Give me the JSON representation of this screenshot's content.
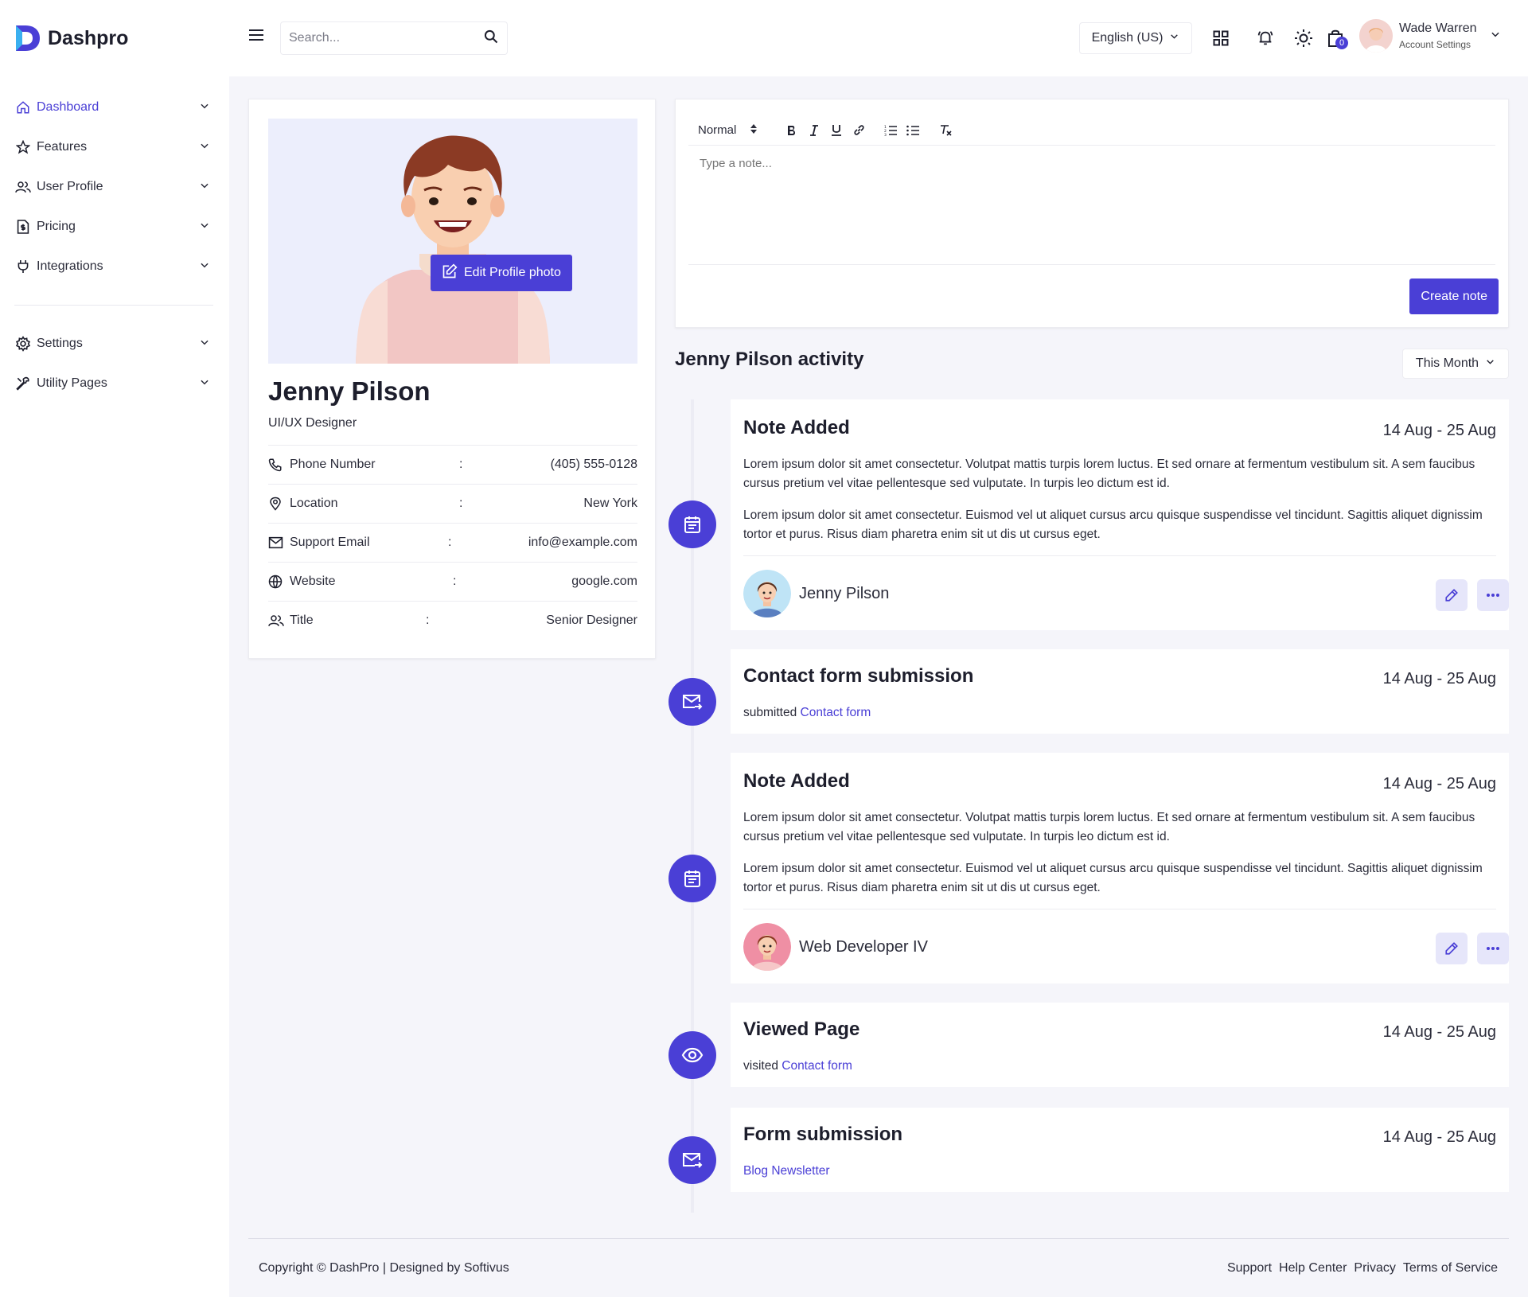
{
  "brand": {
    "name": "Dashpro",
    "accent": "#4a3fd6"
  },
  "sidebar": {
    "items": [
      {
        "label": "Dashboard",
        "icon": "home-icon",
        "active": true
      },
      {
        "label": "Features",
        "icon": "star-icon"
      },
      {
        "label": "User Profile",
        "icon": "users-icon"
      },
      {
        "label": "Pricing",
        "icon": "invoice-icon"
      },
      {
        "label": "Integrations",
        "icon": "plug-icon"
      }
    ],
    "secondary": [
      {
        "label": "Settings",
        "icon": "gear-icon"
      },
      {
        "label": "Utility Pages",
        "icon": "tools-icon"
      }
    ]
  },
  "header": {
    "search_placeholder": "Search...",
    "language": "English (US)",
    "cart_count": "0",
    "user_name": "Wade Warren",
    "user_sub": "Account Settings"
  },
  "profile": {
    "edit_photo": "Edit Profile photo",
    "name": "Jenny Pilson",
    "role": "UI/UX Designer",
    "details": [
      {
        "label": "Phone Number",
        "value": "(405) 555-0128",
        "icon": "phone-icon"
      },
      {
        "label": "Location",
        "value": "New York",
        "icon": "location-icon"
      },
      {
        "label": "Support Email",
        "value": "info@example.com",
        "icon": "mail-icon"
      },
      {
        "label": "Website",
        "value": "google.com",
        "icon": "globe-icon"
      },
      {
        "label": "Title",
        "value": "Senior Designer",
        "icon": "users-icon"
      }
    ],
    "colon": ":"
  },
  "editor": {
    "format": "Normal",
    "placeholder": "Type a note...",
    "create_label": "Create note"
  },
  "activity": {
    "title": "Jenny Pilson activity",
    "filter": "This Month",
    "items": [
      {
        "title": "Note Added",
        "date": "14 Aug - 25 Aug",
        "p1": "Lorem ipsum dolor sit amet consectetur. Volutpat mattis turpis lorem luctus. Et sed ornare at fermentum vestibulum sit. A sem faucibus cursus pretium vel vitae pellentesque sed vulputate. In turpis leo dictum est id.",
        "p2": "Lorem ipsum dolor sit amet consectetur. Euismod vel ut aliquet cursus arcu quisque suspendisse vel tincidunt. Sagittis aliquet dignissim tortor et purus. Risus diam pharetra enim sit ut dis ut cursus eget.",
        "user": "Jenny Pilson"
      },
      {
        "title": "Contact form submission",
        "date": "14 Aug - 25 Aug",
        "prefix": "submitted",
        "link": "Contact form"
      },
      {
        "title": "Note Added",
        "date": "14 Aug - 25 Aug",
        "p1": "Lorem ipsum dolor sit amet consectetur. Volutpat mattis turpis lorem luctus. Et sed ornare at fermentum vestibulum sit. A sem faucibus cursus pretium vel vitae pellentesque sed vulputate. In turpis leo dictum est id.",
        "p2": "Lorem ipsum dolor sit amet consectetur. Euismod vel ut aliquet cursus arcu quisque suspendisse vel tincidunt. Sagittis aliquet dignissim tortor et purus. Risus diam pharetra enim sit ut dis ut cursus eget.",
        "user": "Web Developer IV"
      },
      {
        "title": "Viewed Page",
        "date": "14 Aug - 25 Aug",
        "prefix": "visited",
        "link": "Contact form"
      },
      {
        "title": "Form submission",
        "date": "14 Aug - 25 Aug",
        "link": "Blog Newsletter"
      }
    ]
  },
  "footer": {
    "copyright": "Copyright © DashPro | Designed by Softivus",
    "links": [
      "Support",
      "Help Center",
      "Privacy",
      "Terms of Service"
    ]
  }
}
